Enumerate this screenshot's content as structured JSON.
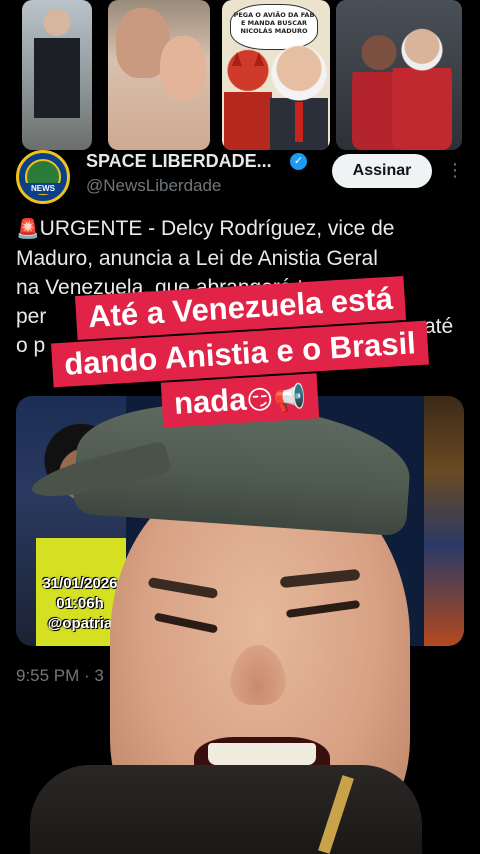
{
  "feed": {
    "thumb_cartoon_bubble": "PEGA O AVIÃO DA FAB E MANDA BUSCAR NICOLÁS MADURO"
  },
  "post": {
    "display_name": "SPACE LIBERDADE...",
    "handle": "@NewsLiberdade",
    "subscribe_label": "Assinar",
    "avatar_tag": "NEWS",
    "siren": "🚨",
    "text_lines": [
      "URGENTE - Delcy Rodríguez, vice de",
      "Maduro, anuncia a Lei de Anistia Geral",
      "na Venezuela, que abrangerá to",
      "per",
      "o p"
    ],
    "text_tail": "até",
    "time": "9:55 PM · 3"
  },
  "media": {
    "stamp_date": "31/01/2026",
    "stamp_time": "01:06h",
    "stamp_user": "@opatria"
  },
  "caption": {
    "line1": "Até a Venezuela está",
    "line2": "dando Anistia e o Brasil",
    "line3": "nada",
    "line3_emoji": "😏📢"
  },
  "colors": {
    "caption_bg": "#e02346",
    "verified": "#1d9bf0",
    "muted_text": "#71767b"
  },
  "icons": [
    "verified-badge-icon",
    "more-options-icon",
    "siren-icon"
  ]
}
